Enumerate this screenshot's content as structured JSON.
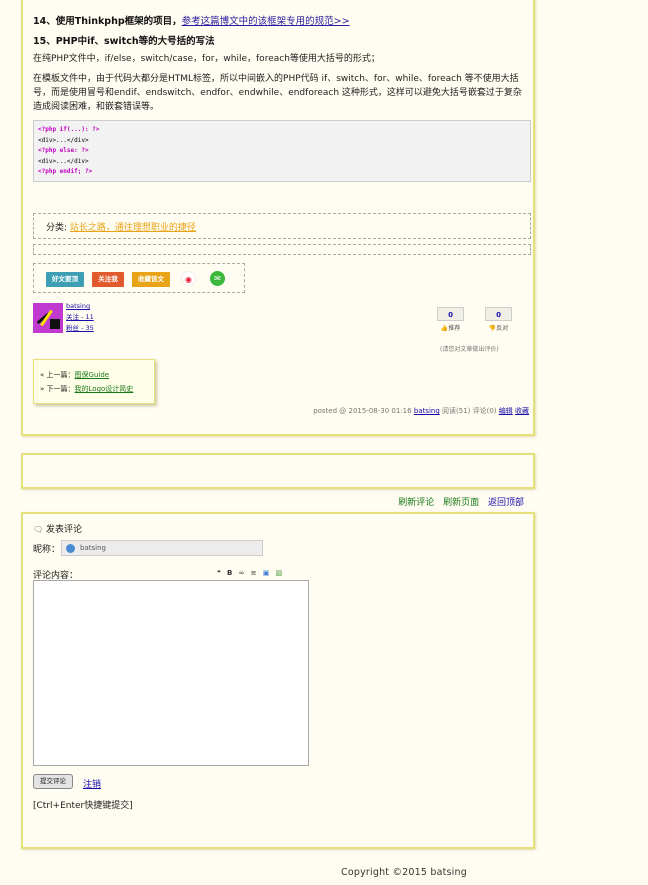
{
  "post": {
    "heading14_prefix": "14、使用Thinkphp框架的项目，",
    "heading14_link": "参考这篇博文中的该框架专用的规范>>",
    "heading15": "15、PHP中if、switch等的大号括的写法",
    "para1": "在纯PHP文件中，if/else，switch/case，for，while，foreach等使用大括号的形式；",
    "para2": "在模板文件中，由于代码大都分是HTML标签，所以中间嵌入的PHP代码 if、switch、for、while、foreach 等不使用大括号，而是使用冒号和endif、endswitch、endfor、endwhile、endforeach 这种形式，这样可以避免大括号嵌套过于复杂造成阅读困难，和嵌套错误等。",
    "code": [
      {
        "kw": "<?php if(...): ?>",
        "tx": ""
      },
      {
        "kw": "",
        "tx": "<div>...</div>"
      },
      {
        "kw": "<?php else: ?>",
        "tx": ""
      },
      {
        "kw": "",
        "tx": "<div>...</div>"
      },
      {
        "kw": "<?php endif; ?>",
        "tx": ""
      }
    ],
    "category_label": "分类:",
    "category_link": "站长之路，通往理想职业的捷径",
    "share": {
      "good": "好文要顶",
      "follow": "关注我",
      "favorite": "收藏该文",
      "weibo_icon": "weibo-icon",
      "wechat_icon": "wechat-icon"
    },
    "author": {
      "name": "batsing",
      "follow_text": "关注 - 11",
      "fans_text": "粉丝 - 35"
    },
    "vote": {
      "digg_count": "0",
      "digg_label": "推荐",
      "bury_count": "0",
      "bury_label": "反对",
      "note": "(请您对文章做出评价)"
    },
    "prev_label": "« 上一篇：",
    "prev_link": "图保Guide",
    "next_label": "» 下一篇：",
    "next_link": "我的Logo设计简史",
    "info_prefix": "posted @ 2015-08-30 01:16",
    "info_author": "batsing",
    "info_reads": "阅读(51) 评论(0)",
    "info_edit": "编辑",
    "info_fav": "收藏"
  },
  "links": {
    "refresh_comments": "刷新评论",
    "refresh_page": "刷新页面",
    "back_top": "返回顶部"
  },
  "comment": {
    "title": "发表评论",
    "nick_label": "昵称：",
    "nick_value": "batsing",
    "content_label": "评论内容：",
    "submit": "提交评论",
    "logout": "注销",
    "hint": "[Ctrl+Enter快捷键提交]"
  },
  "footer": {
    "copyright": "Copyright ©2015 batsing"
  },
  "colors": {
    "panel_border": "#e6e07a",
    "background": "#fffcf1",
    "good_btn": "#3e9fb4",
    "follow_btn": "#e05a2b",
    "favorite_btn": "#e8a317"
  }
}
